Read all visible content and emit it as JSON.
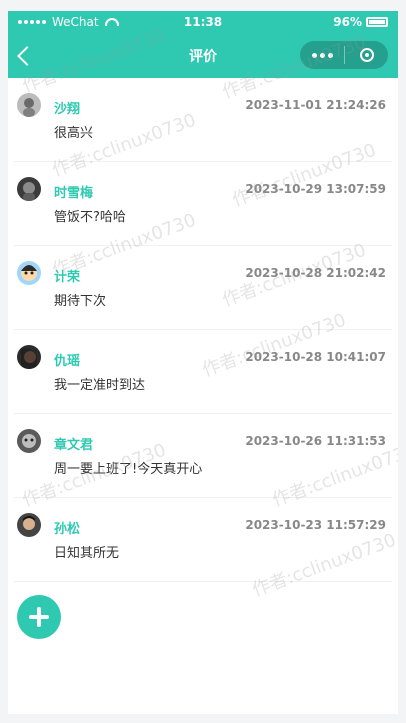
{
  "status_bar": {
    "carrier": "WeChat",
    "time": "11:38",
    "battery": "96%"
  },
  "nav": {
    "title": "评价"
  },
  "reviews": [
    {
      "name": "沙翔",
      "time": "2023-11-01 21:24:26",
      "comment": "很高兴"
    },
    {
      "name": "时雪梅",
      "time": "2023-10-29 13:07:59",
      "comment": "管饭不?哈哈"
    },
    {
      "name": "计荣",
      "time": "2023-10-28 21:02:42",
      "comment": "期待下次"
    },
    {
      "name": "仇瑶",
      "time": "2023-10-28 10:41:07",
      "comment": "我一定准时到达"
    },
    {
      "name": "章文君",
      "time": "2023-10-26 11:31:53",
      "comment": "周一要上班了!今天真开心"
    },
    {
      "name": "孙松",
      "time": "2023-10-23 11:57:29",
      "comment": "日知其所无"
    }
  ],
  "watermark": "作者:cclinux0730",
  "colors": {
    "accent": "#2fc9b2",
    "capsule": "#25a08e",
    "name_color": "#2fc9b2",
    "time_color": "#888888",
    "text_color": "#333333"
  }
}
